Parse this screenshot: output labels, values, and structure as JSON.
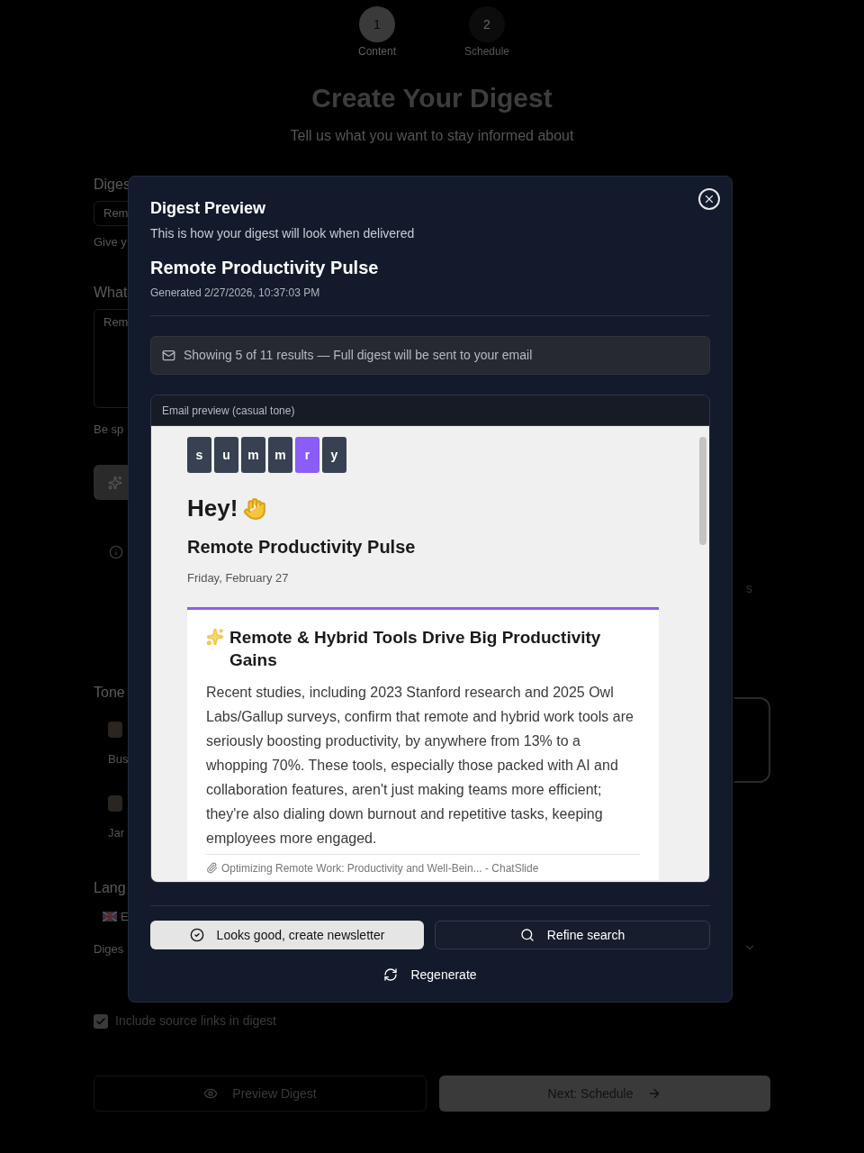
{
  "stepper": [
    {
      "number": "1",
      "label": "Content",
      "selected": true
    },
    {
      "number": "2",
      "label": "Schedule",
      "selected": false
    }
  ],
  "page": {
    "title": "Create Your Digest",
    "subtitle": "Tell us what you want to stay informed about"
  },
  "form_fragments": [
    {
      "kind": "label",
      "text": "Diges"
    },
    {
      "kind": "field",
      "text": "Rem"
    },
    {
      "kind": "hint",
      "text": "Give y"
    },
    {
      "kind": "label",
      "text": "What"
    },
    {
      "kind": "textarea",
      "text": "Rem"
    },
    {
      "kind": "hint",
      "text": "Be sp"
    },
    {
      "kind": "action"
    },
    {
      "kind": "info"
    },
    {
      "kind": "label",
      "text": "Tone"
    },
    {
      "kind": "tone",
      "text": "Bus"
    },
    {
      "kind": "tone",
      "text": "Jar"
    },
    {
      "kind": "label",
      "text": "Lang"
    },
    {
      "kind": "select",
      "text": "E"
    },
    {
      "kind": "hint",
      "text": "Diges"
    }
  ],
  "right_fragment": "s",
  "source_links": {
    "label": "Include source links in digest",
    "checked": true
  },
  "footer": [
    {
      "label": "Preview Digest",
      "kind": "outline"
    },
    {
      "label": "Next: Schedule",
      "kind": "solid"
    }
  ],
  "modal": {
    "title": "Digest Preview",
    "subtitle": "This is how your digest will look when delivered",
    "digest_title": "Remote Productivity Pulse",
    "generated": "Generated 2/27/2026, 10:37:03 PM",
    "notice": "Showing 5 of 11 results — Full digest will be sent to your email",
    "preview": {
      "header": "Email preview (casual tone)",
      "logo": [
        {
          "letter": "s",
          "highlighted": false
        },
        {
          "letter": "u",
          "highlighted": false
        },
        {
          "letter": "m",
          "highlighted": false
        },
        {
          "letter": "m",
          "highlighted": false
        },
        {
          "letter": "r",
          "highlighted": true
        },
        {
          "letter": "y",
          "highlighted": false
        }
      ],
      "greeting": "Hey!",
      "title": "Remote Productivity Pulse",
      "date": "Friday, February 27",
      "story": {
        "headline": "Remote & Hybrid Tools Drive Big Productivity Gains",
        "body": "Recent studies, including 2023 Stanford research and 2025 Owl Labs/Gallup surveys, confirm that remote and hybrid work tools are seriously boosting productivity, by anywhere from 13% to a whopping 70%. These tools, especially those packed with AI and collaboration features, aren't just making teams more efficient; they're also dialing down burnout and repetitive tasks, keeping employees more engaged.",
        "source": "Optimizing Remote Work: Productivity and Well-Bein... - ChatSlide"
      }
    },
    "actions": [
      {
        "label": "Looks good, create newsletter",
        "kind": "primary"
      },
      {
        "label": "Refine search",
        "kind": "secondary"
      }
    ],
    "regenerate": "Regenerate"
  }
}
